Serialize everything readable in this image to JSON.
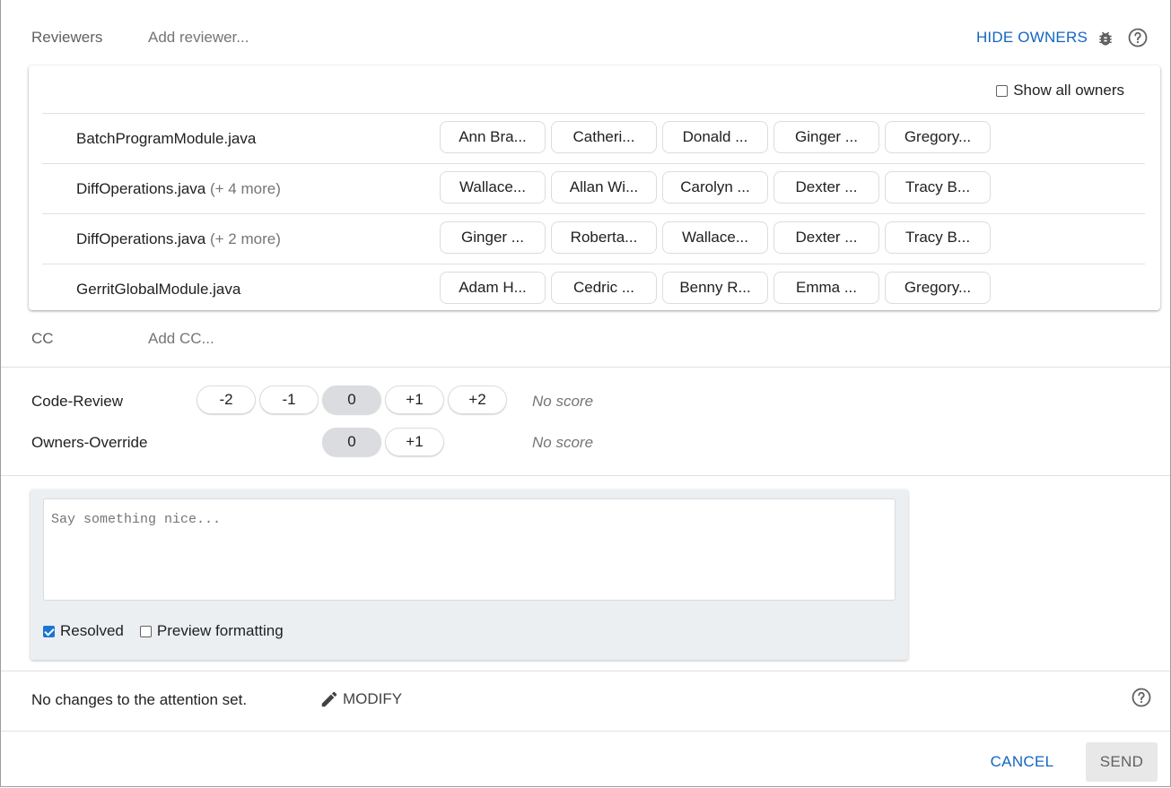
{
  "reviewers": {
    "label": "Reviewers",
    "placeholder": "Add reviewer...",
    "hide_owners_label": "HIDE OWNERS"
  },
  "owners": {
    "show_all_label": "Show all owners",
    "show_all_checked": false,
    "files": [
      {
        "name": "BatchProgramModule.java",
        "more": "",
        "owners": [
          "Ann Bra...",
          "Catheri...",
          "Donald ...",
          "Ginger ...",
          "Gregory..."
        ]
      },
      {
        "name": "DiffOperations.java",
        "more": "(+ 4 more)",
        "owners": [
          "Wallace...",
          "Allan Wi...",
          "Carolyn ...",
          "Dexter ...",
          "Tracy B..."
        ]
      },
      {
        "name": "DiffOperations.java",
        "more": "(+ 2 more)",
        "owners": [
          "Ginger ...",
          "Roberta...",
          "Wallace...",
          "Dexter ...",
          "Tracy B..."
        ]
      },
      {
        "name": "GerritGlobalModule.java",
        "more": "",
        "owners": [
          "Adam H...",
          "Cedric ...",
          "Benny R...",
          "Emma ...",
          "Gregory..."
        ]
      }
    ]
  },
  "cc": {
    "label": "CC",
    "placeholder": "Add CC..."
  },
  "labels": {
    "code_review": {
      "name": "Code-Review",
      "votes": [
        "-2",
        "-1",
        "0",
        "+1",
        "+2"
      ],
      "selected": "0",
      "status": "No score"
    },
    "owners_override": {
      "name": "Owners-Override",
      "votes": [
        "0",
        "+1"
      ],
      "selected": "0",
      "status": "No score"
    }
  },
  "comment": {
    "placeholder": "Say something nice...",
    "resolved_label": "Resolved",
    "resolved_checked": true,
    "preview_label": "Preview formatting",
    "preview_checked": false
  },
  "attention": {
    "text": "No changes to the attention set.",
    "modify_label": "MODIFY"
  },
  "footer": {
    "cancel_label": "CANCEL",
    "send_label": "SEND"
  },
  "colors": {
    "accent": "#1565c0",
    "selected_vote": "#dadce0",
    "comment_panel_bg": "#eceff1"
  }
}
